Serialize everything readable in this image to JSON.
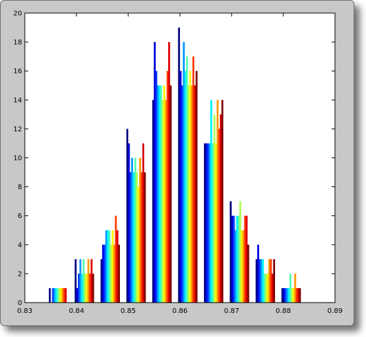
{
  "chart_data": {
    "type": "bar",
    "title": "",
    "xlabel": "",
    "ylabel": "",
    "xlim": [
      0.83,
      0.89
    ],
    "ylim": [
      0,
      20
    ],
    "xticks": [
      "0.83",
      "0.84",
      "0.85",
      "0.86",
      "0.87",
      "0.88",
      "0.89"
    ],
    "yticks": [
      "0",
      "2",
      "4",
      "6",
      "8",
      "10",
      "12",
      "14",
      "16",
      "18",
      "20"
    ],
    "grid": false,
    "legend": "none",
    "colormap": "jet",
    "bin_centers": [
      0.8365,
      0.8415,
      0.8465,
      0.8515,
      0.8565,
      0.8615,
      0.8665,
      0.8715,
      0.8765,
      0.8815
    ],
    "series": [
      {
        "values": [
          1,
          3,
          3,
          12,
          14,
          19,
          11,
          7,
          3,
          1
        ]
      },
      {
        "values": [
          0,
          1,
          4,
          11,
          18,
          16,
          11,
          6,
          4,
          1
        ]
      },
      {
        "values": [
          1,
          2,
          4,
          9,
          16,
          15,
          11,
          6,
          3,
          1
        ]
      },
      {
        "values": [
          1,
          3,
          5,
          10,
          15,
          18,
          11,
          5,
          3,
          1
        ]
      },
      {
        "values": [
          1,
          2,
          5,
          9,
          15,
          16,
          14,
          6,
          3,
          1
        ]
      },
      {
        "values": [
          1,
          3,
          5,
          10,
          15,
          17,
          11,
          6,
          2,
          2
        ]
      },
      {
        "values": [
          1,
          2,
          4,
          9,
          14,
          15,
          13,
          7,
          2,
          1
        ]
      },
      {
        "values": [
          1,
          2,
          5,
          8,
          15,
          16,
          11,
          5,
          2,
          1
        ]
      },
      {
        "values": [
          1,
          3,
          4,
          10,
          14,
          15,
          14,
          5,
          3,
          2
        ]
      },
      {
        "values": [
          1,
          2,
          6,
          9,
          16,
          17,
          12,
          6,
          3,
          1
        ]
      },
      {
        "values": [
          1,
          3,
          5,
          11,
          18,
          15,
          13,
          6,
          2,
          1
        ]
      },
      {
        "values": [
          0,
          2,
          4,
          9,
          15,
          16,
          14,
          4,
          3,
          1
        ]
      }
    ]
  }
}
